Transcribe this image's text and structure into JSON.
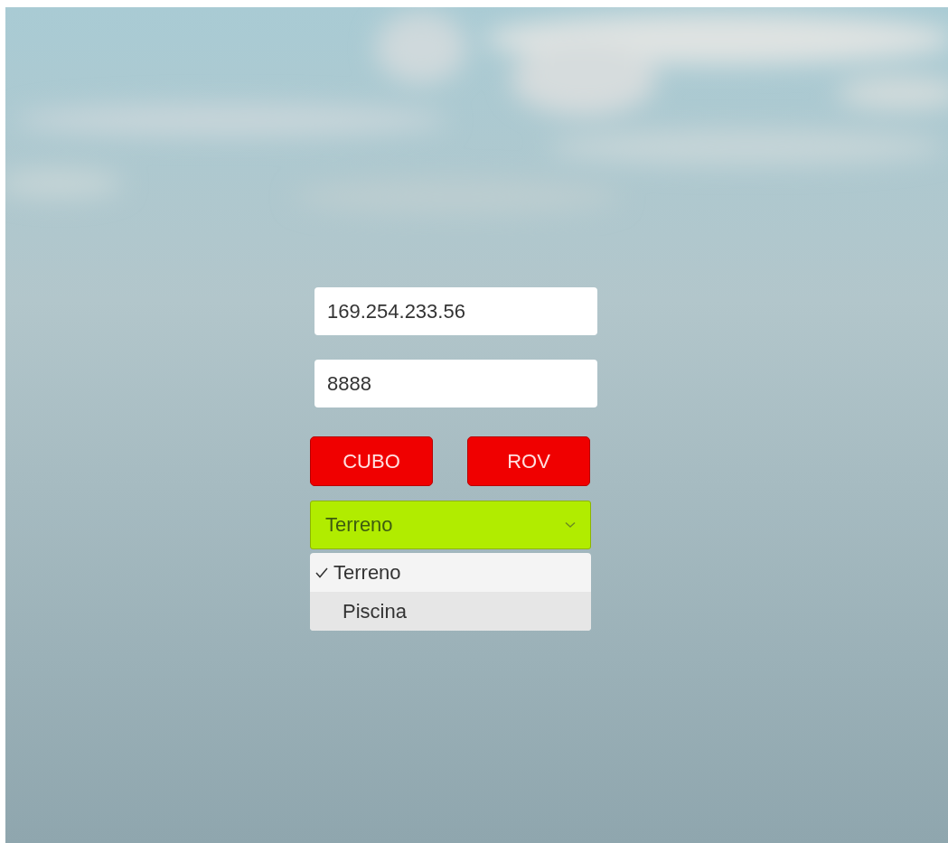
{
  "fields": [
    {
      "value": "169.254.233.56"
    },
    {
      "value": "8888"
    }
  ],
  "buttons": [
    {
      "label": "CUBO"
    },
    {
      "label": "ROV"
    }
  ],
  "dropdown": {
    "value": "Terreno",
    "expanded": true,
    "options": [
      {
        "label": "Terreno",
        "selected": true,
        "highlighted": false
      },
      {
        "label": "Piscina",
        "selected": false,
        "highlighted": true
      }
    ]
  }
}
